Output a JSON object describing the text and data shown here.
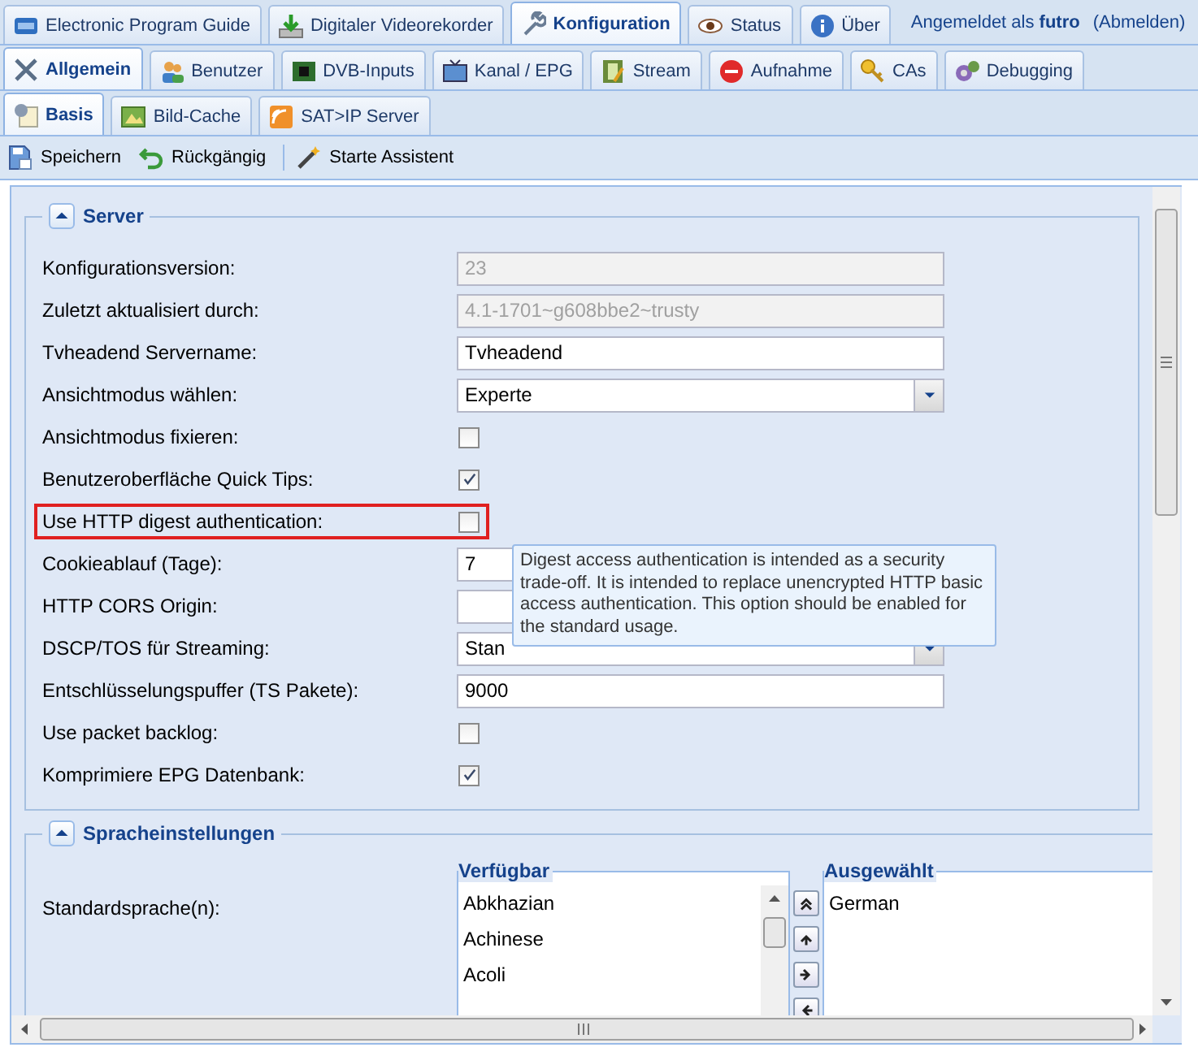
{
  "top_tabs": [
    {
      "label": "Electronic Program Guide",
      "selected": false
    },
    {
      "label": "Digitaler Videorekorder",
      "selected": false
    },
    {
      "label": "Konfiguration",
      "selected": true
    },
    {
      "label": "Status",
      "selected": false
    },
    {
      "label": "Über",
      "selected": false
    }
  ],
  "user_status": "Angemeldet als **futro**",
  "logout_link": "(Abmelden)",
  "section_tabs": [
    {
      "label": "Allgemein",
      "selected": true
    },
    {
      "label": "Benutzer",
      "selected": false
    },
    {
      "label": "DVB-Inputs",
      "selected": false
    },
    {
      "label": "Kanal / EPG",
      "selected": false
    },
    {
      "label": "Stream",
      "selected": false
    },
    {
      "label": "Aufnahme",
      "selected": false
    },
    {
      "label": "CAs",
      "selected": false
    },
    {
      "label": "Debugging",
      "selected": false
    }
  ],
  "sub_tabs": [
    {
      "label": "Basis",
      "selected": true
    },
    {
      "label": "Bild-Cache",
      "selected": false
    },
    {
      "label": "SAT>IP Server",
      "selected": false
    }
  ],
  "toolbar": [
    "Speichern",
    "Rückgängig",
    "Starte Assistent"
  ],
  "server": {
    "title": "Server",
    "expanded": true,
    "rows": [
      {
        "label": "Konfigurationsversion:",
        "kind": "readonly",
        "value": "23",
        "highlighted": false
      },
      {
        "label": "Zuletzt aktualisiert durch:",
        "kind": "readonly",
        "value": "4.1-1701~g608bbe2~trusty",
        "highlighted": false
      },
      {
        "label": "Tvheadend Servername:",
        "kind": "text",
        "value": "Tvheadend",
        "highlighted": false
      },
      {
        "label": "Ansichtmodus wählen:",
        "kind": "select",
        "value": "Experte",
        "highlighted": false
      },
      {
        "label": "Ansichtmodus fixieren:",
        "kind": "checkbox",
        "checked": false,
        "highlighted": false
      },
      {
        "label": "Benutzeroberfläche Quick Tips:",
        "kind": "checkbox",
        "checked": true,
        "highlighted": false
      },
      {
        "label": "Use HTTP digest authentication:",
        "kind": "checkbox",
        "checked": false,
        "highlighted": true
      },
      {
        "label": "Cookieablauf (Tage):",
        "kind": "text",
        "value": "7",
        "highlighted": false
      },
      {
        "label": "HTTP CORS Origin:",
        "kind": "text",
        "highlighted": false
      },
      {
        "label": "DSCP/TOS für Streaming:",
        "kind": "select",
        "value": "Stan",
        "highlighted": false
      },
      {
        "label": "Entschlüsselungspuffer (TS Pakete):",
        "kind": "text",
        "value": "9000",
        "highlighted": false
      },
      {
        "label": "Use packet backlog:",
        "kind": "checkbox",
        "checked": false,
        "highlighted": false
      },
      {
        "label": "Komprimiere EPG Datenbank:",
        "kind": "checkbox",
        "checked": true,
        "highlighted": false
      }
    ]
  },
  "tooltip": "Digest access authentication is intended as a security trade-off. It is intended to replace unencrypted HTTP basic access authentication. This option should be enabled for the standard usage.",
  "language": {
    "title": "Spracheinstellungen",
    "expanded": true,
    "label": "Standardsprache(n):",
    "available": {
      "title": "Verfügbar",
      "items": [
        {
          "label": "Abkhazian",
          "selected": false
        },
        {
          "label": "Achinese",
          "selected": false
        },
        {
          "label": "Acoli",
          "selected": false
        }
      ]
    },
    "chosen": {
      "title": "Ausgewählt",
      "items": [
        {
          "label": "German",
          "selected": false
        }
      ]
    }
  }
}
